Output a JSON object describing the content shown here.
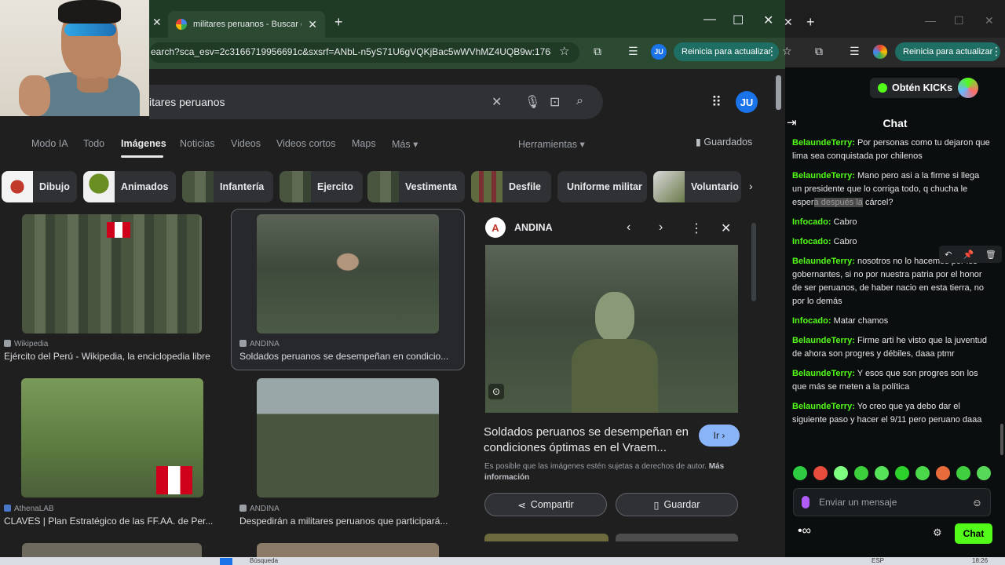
{
  "left_window": {
    "tab_title": "militares peruanos - Buscar con",
    "url": "earch?sca_esv=2c3166719956691c&sxsrf=ANbL-n5yS71U6gVQKjBac5wWVhMZ4UQB9w:176877...",
    "update_button": "Reinicia para actualizar",
    "profile_initials": "JU"
  },
  "search": {
    "query": "itares peruanos",
    "profile_initials": "JU"
  },
  "nav_tabs": [
    "Modo IA",
    "Todo",
    "Imágenes",
    "Noticias",
    "Videos",
    "Videos cortos",
    "Maps",
    "Más"
  ],
  "tools_label": "Herramientas",
  "saved_label": "Guardados",
  "chips": [
    "Dibujo",
    "Animados",
    "Infantería",
    "Ejercito",
    "Vestimenta",
    "Desfile",
    "Uniforme militar",
    "Voluntario"
  ],
  "results": [
    {
      "source": "Wikipedia",
      "caption": "Ejército del Perú - Wikipedia, la enciclopedia libre"
    },
    {
      "source": "ANDINA",
      "caption": "Soldados peruanos se desempeñan en condicio..."
    },
    {
      "source": "AthenaLAB",
      "caption": "CLAVES | Plan Estratégico de las FF.AA. de Per..."
    },
    {
      "source": "ANDINA",
      "caption": "Despedirán a militares peruanos que participará..."
    }
  ],
  "preview": {
    "source_initial": "A",
    "source": "ANDINA",
    "title": "Soldados peruanos se desempeñan en condiciones óptimas en el Vraem...",
    "go_button": "Ir",
    "note": "Es posible que las imágenes estén sujetas a derechos de autor.",
    "more_info": "Más información",
    "share_button": "Compartir",
    "save_button": "Guardar"
  },
  "right_window": {
    "update_button": "Reinicia para actualizar",
    "kicks_button": "Obtén KICKs",
    "chat_title": "Chat",
    "messages": [
      {
        "user": "BelaundeTerry",
        "text": " Por personas como tu dejaron que lima sea conquistada por chilenos"
      },
      {
        "user": "BelaundeTerry",
        "text": " Mano pero asi a la firme si llega un presidente que lo corriga todo, q chucha le esper",
        "highlight": "a después la",
        "tail": " cárcel?"
      },
      {
        "user": "Infocado",
        "text": " Cabro"
      },
      {
        "user": "Infocado",
        "text": " Cabro"
      },
      {
        "user": "BelaundeTerry",
        "text": " nosotros no lo hacemos por los gobernantes, si no por nuestra patria por el honor de ser peruanos, de haber nacio en esta tierra, no por lo demás"
      },
      {
        "user": "Infocado",
        "text": " Matar chamos"
      },
      {
        "user": "BelaundeTerry",
        "text": " Firme arti he visto que la juventud de ahora son progres y débiles, daaa ptmr"
      },
      {
        "user": "BelaundeTerry",
        "text": " Y esos que son progres son los que más se meten a la política"
      },
      {
        "user": "BelaundeTerry",
        "text": " Yo creo que ya debo dar el siguiente paso y hacer el 9/11 pero peruano daaa"
      }
    ],
    "input_placeholder": "Enviar un mensaje",
    "send_button": "Chat",
    "emote_colors": [
      "#2ecc40",
      "#e74c3c",
      "#7fff7f",
      "#3cd13c",
      "#56e35a",
      "#2bd02b",
      "#4bd84b",
      "#e86b3c",
      "#3fcf3f",
      "#58d858"
    ]
  },
  "taskbar": {
    "search_hint": "Búsqueda",
    "lang": "ESP",
    "time": "18:26"
  }
}
